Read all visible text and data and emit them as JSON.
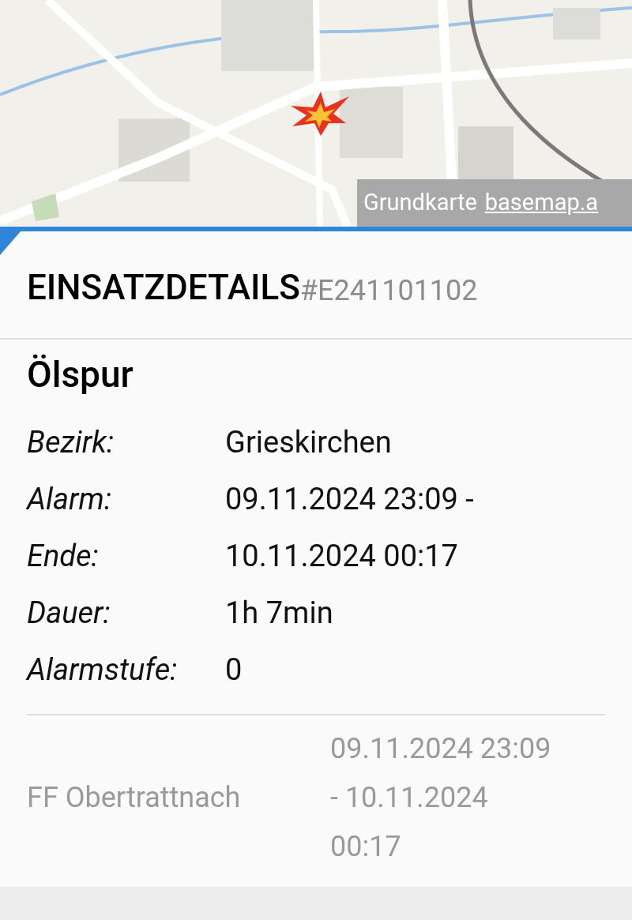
{
  "map": {
    "attribution": {
      "text": "Grundkarte",
      "link": "basemap.a"
    }
  },
  "header": {
    "title": "EINSATZDETAILS",
    "id": "#E241101102"
  },
  "incident": {
    "title": "Ölspur",
    "fields": [
      {
        "label": "Bezirk:",
        "value": "Grieskirchen"
      },
      {
        "label": "Alarm:",
        "value": "09.11.2024 23:09 -"
      },
      {
        "label": "Ende:",
        "value": "10.11.2024 00:17"
      },
      {
        "label": "Dauer:",
        "value": "1h 7min"
      },
      {
        "label": "Alarmstufe:",
        "value": "0"
      }
    ]
  },
  "units": [
    {
      "name": "FF Obertrattnach",
      "time": "09.11.2024 23:09 - 10.11.2024 00:17"
    }
  ]
}
